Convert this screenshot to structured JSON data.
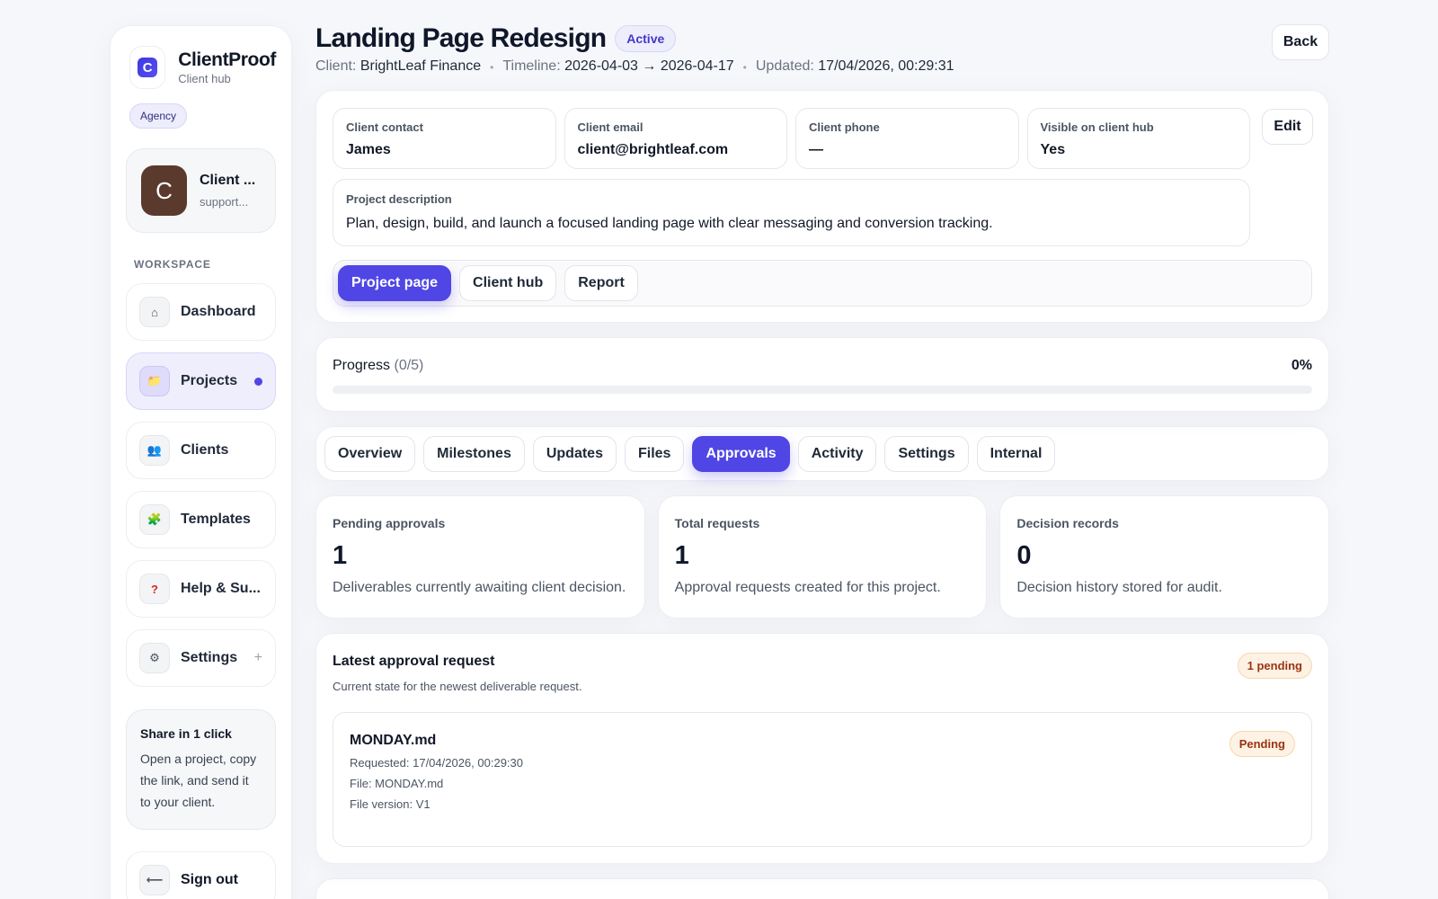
{
  "brand": {
    "name": "ClientProof",
    "subtitle": "Client hub",
    "logo_letter": "C",
    "accent": "#4f46e5"
  },
  "sidebar": {
    "role_badge": "Agency",
    "user": {
      "initial": "C",
      "name": "Client ...",
      "email": "support..."
    },
    "section_label": "WORKSPACE",
    "items": [
      {
        "label": "Dashboard",
        "icon": "⌂",
        "icon_name": "home-icon"
      },
      {
        "label": "Projects",
        "icon": "📁",
        "icon_name": "folder-icon"
      },
      {
        "label": "Clients",
        "icon": "👥",
        "icon_name": "users-icon"
      },
      {
        "label": "Templates",
        "icon": "🧩",
        "icon_name": "puzzle-icon"
      },
      {
        "label": "Help & Su...",
        "icon": "?",
        "icon_name": "help-icon"
      },
      {
        "label": "Settings",
        "icon": "⚙",
        "icon_name": "gear-icon",
        "trailing": "+"
      }
    ],
    "share": {
      "title": "Share in 1 click",
      "text": "Open a project, copy the link, and send it to your client."
    },
    "signout": {
      "label": "Sign out",
      "icon": "⟵"
    }
  },
  "header": {
    "title": "Landing Page Redesign",
    "status": "Active",
    "back_label": "Back",
    "meta": {
      "client_label": "Client:",
      "client_value": "BrightLeaf Finance",
      "timeline_label": "Timeline:",
      "timeline_value": "2026-04-03 → 2026-04-17",
      "updated_label": "Updated:",
      "updated_value": "17/04/2026, 00:29:31",
      "separator": "•"
    }
  },
  "info": {
    "fields": [
      {
        "label": "Client contact",
        "value": "James"
      },
      {
        "label": "Client email",
        "value": "client@brightleaf.com"
      },
      {
        "label": "Client phone",
        "value": "—"
      },
      {
        "label": "Visible on client hub",
        "value": "Yes"
      }
    ],
    "edit_label": "Edit",
    "description": {
      "label": "Project description",
      "value": "Plan, design, build, and launch a focused landing page with clear messaging and conversion tracking."
    },
    "links": [
      "Project page",
      "Client hub",
      "Report"
    ]
  },
  "progress": {
    "label": "Progress",
    "count": "(0/5)",
    "percent_text": "0%",
    "fraction": 0
  },
  "tabs": [
    "Overview",
    "Milestones",
    "Updates",
    "Files",
    "Approvals",
    "Activity",
    "Settings",
    "Internal"
  ],
  "active_tab": "Approvals",
  "stats": [
    {
      "label": "Pending approvals",
      "value": "1",
      "desc": "Deliverables currently awaiting client decision."
    },
    {
      "label": "Total requests",
      "value": "1",
      "desc": "Approval requests created for this project."
    },
    {
      "label": "Decision records",
      "value": "0",
      "desc": "Decision history stored for audit."
    }
  ],
  "approval": {
    "title": "Latest approval request",
    "subtitle": "Current state for the newest deliverable request.",
    "badge": "1 pending",
    "request": {
      "file_name": "MONDAY.md",
      "requested": "Requested: 17/04/2026, 00:29:30",
      "file": "File: MONDAY.md",
      "version": "File version: V1",
      "status": "Pending"
    }
  }
}
